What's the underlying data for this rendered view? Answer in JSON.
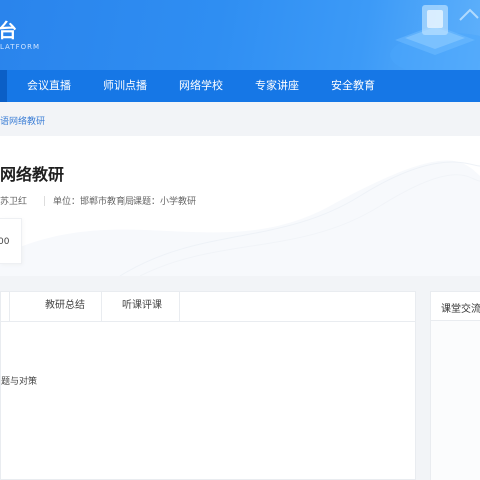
{
  "header": {
    "logo_title": "台",
    "logo_subtitle": "LATFORM"
  },
  "nav": {
    "items": [
      {
        "label": "会议直播"
      },
      {
        "label": "师训点播"
      },
      {
        "label": "网络学校"
      },
      {
        "label": "专家讲座"
      },
      {
        "label": "安全教育"
      }
    ]
  },
  "breadcrumb": {
    "text": "语网络教研"
  },
  "info": {
    "title": "网络教研",
    "speaker": "苏卫红",
    "unit": "单位：邯郸市教育局",
    "topic": "课题：小学教研",
    "count": "00"
  },
  "tabs": [
    {
      "label": "教研总结"
    },
    {
      "label": "听课评课"
    }
  ],
  "content": {
    "line": "题与对策"
  },
  "side": {
    "title": "课堂交流"
  },
  "colors": {
    "header": "#2f8ef2",
    "nav": "#1677e6",
    "link": "#3d7fd6"
  }
}
